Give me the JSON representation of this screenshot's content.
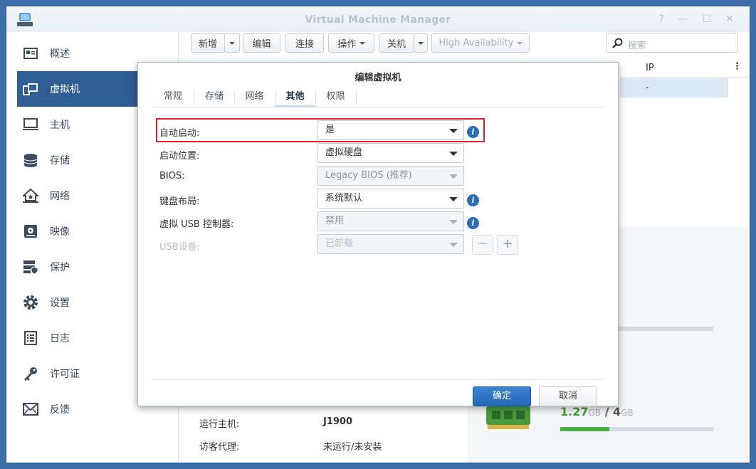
{
  "app": {
    "title": "Virtual Machine Manager"
  },
  "sidebar": {
    "items": [
      {
        "label": "概述",
        "icon": "overview-icon"
      },
      {
        "label": "虚拟机",
        "icon": "vm-icon",
        "active": true
      },
      {
        "label": "主机",
        "icon": "host-icon"
      },
      {
        "label": "存储",
        "icon": "storage-icon"
      },
      {
        "label": "网络",
        "icon": "network-icon"
      },
      {
        "label": "映像",
        "icon": "image-icon"
      },
      {
        "label": "保护",
        "icon": "protection-icon"
      },
      {
        "label": "设置",
        "icon": "settings-icon"
      },
      {
        "label": "日志",
        "icon": "log-icon"
      },
      {
        "label": "许可证",
        "icon": "license-icon"
      },
      {
        "label": "反馈",
        "icon": "feedback-icon"
      }
    ]
  },
  "toolbar": {
    "new_label": "新增",
    "edit_label": "编辑",
    "connect_label": "连接",
    "action_label": "操作",
    "shutdown_label": "关机",
    "ha_label": "High Availability",
    "search_placeholder": "搜索"
  },
  "grid": {
    "ip_header": "IP",
    "ip_value": "-"
  },
  "details": {
    "host_label": "运行主机:",
    "host_value": "J1900",
    "agent_label": "访客代理:",
    "agent_value": "未运行/未安装",
    "memory_used": "1.27",
    "memory_used_unit": "GB",
    "memory_sep": "/",
    "memory_total": "4",
    "memory_total_unit": "GB"
  },
  "dialog": {
    "title": "编辑虚拟机",
    "tabs": [
      "常规",
      "存储",
      "网络",
      "其他",
      "权限"
    ],
    "active_tab": "其他",
    "rows": [
      {
        "label": "自动启动:",
        "value": "是",
        "info": true
      },
      {
        "label": "启动位置:",
        "value": "虚拟硬盘"
      },
      {
        "label": "BIOS:",
        "value": "Legacy BIOS (推荐)"
      },
      {
        "label": "键盘布局:",
        "value": "系统默认",
        "info": true
      },
      {
        "label": "虚拟 USB 控制器:",
        "value": "禁用",
        "info": true
      },
      {
        "label": "USB设备:",
        "value": "已卸载"
      }
    ],
    "ok_label": "确定",
    "cancel_label": "取消"
  },
  "colors": {
    "accent": "#2f5e95",
    "highlight": "#e02328",
    "primary_button": "#2a6db5"
  }
}
